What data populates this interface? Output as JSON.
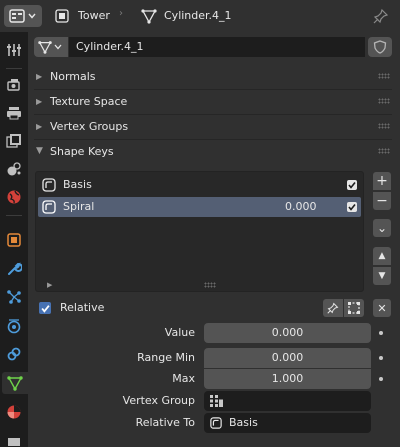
{
  "header": {
    "object_name": "Tower",
    "mesh_name": "Cylinder.4_1"
  },
  "mesh_datablock": {
    "name": "Cylinder.4_1"
  },
  "panels": {
    "normals": "Normals",
    "texture_space": "Texture Space",
    "vertex_groups": "Vertex Groups",
    "shape_keys": "Shape Keys"
  },
  "shape_keys": {
    "items": [
      {
        "name": "Basis",
        "value": "",
        "enabled": true,
        "selected": false
      },
      {
        "name": "Spiral",
        "value": "0.000",
        "enabled": true,
        "selected": true
      }
    ],
    "buttons": {
      "add": "+",
      "remove": "−",
      "specials": "⌄",
      "move_up": "▲",
      "move_down": "▼",
      "clear": "✕"
    },
    "relative": {
      "label": "Relative",
      "checked": true
    }
  },
  "properties": {
    "value": {
      "label": "Value",
      "value": "0.000"
    },
    "range_min": {
      "label": "Range Min",
      "value": "0.000"
    },
    "max": {
      "label": "Max",
      "value": "1.000"
    },
    "vertex_group": {
      "label": "Vertex Group",
      "value": ""
    },
    "relative_to": {
      "label": "Relative To",
      "value": "Basis"
    }
  },
  "colors": {
    "accent": "#4772b3",
    "selected_row": "#545f74",
    "mesh_icon": "#6fd34a"
  }
}
